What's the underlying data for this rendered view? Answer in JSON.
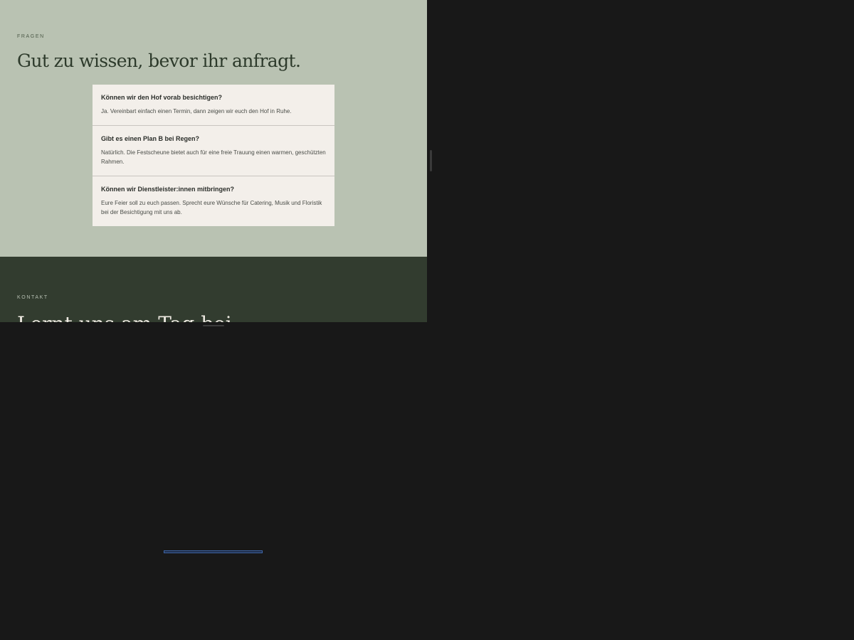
{
  "faq": {
    "eyebrow": "FRAGEN",
    "heading": "Gut zu wissen, bevor ihr anfragt.",
    "items": [
      {
        "question": "Können wir den Hof vorab besichtigen?",
        "answer": "Ja. Vereinbart einfach einen Termin, dann zeigen wir euch den Hof in Ruhe."
      },
      {
        "question": "Gibt es einen Plan B bei Regen?",
        "answer": "Natürlich. Die Festscheune bietet auch für eine freie Trauung einen warmen, geschützten Rahmen."
      },
      {
        "question": "Können wir Dienstleister:innen mitbringen?",
        "answer": "Eure Feier soll zu euch passen. Sprecht eure Wünsche für Catering, Musik und Floristik bei der Besichtigung mit uns ab."
      }
    ]
  },
  "contact": {
    "eyebrow": "KONTAKT",
    "heading": "Lernt uns am Tag bei"
  },
  "colors": {
    "faq_background": "#b9c2b2",
    "contact_background": "#323c2f",
    "card_background": "#f3efea",
    "outer_background": "#181818",
    "accent_blue": "#3f66a8"
  }
}
